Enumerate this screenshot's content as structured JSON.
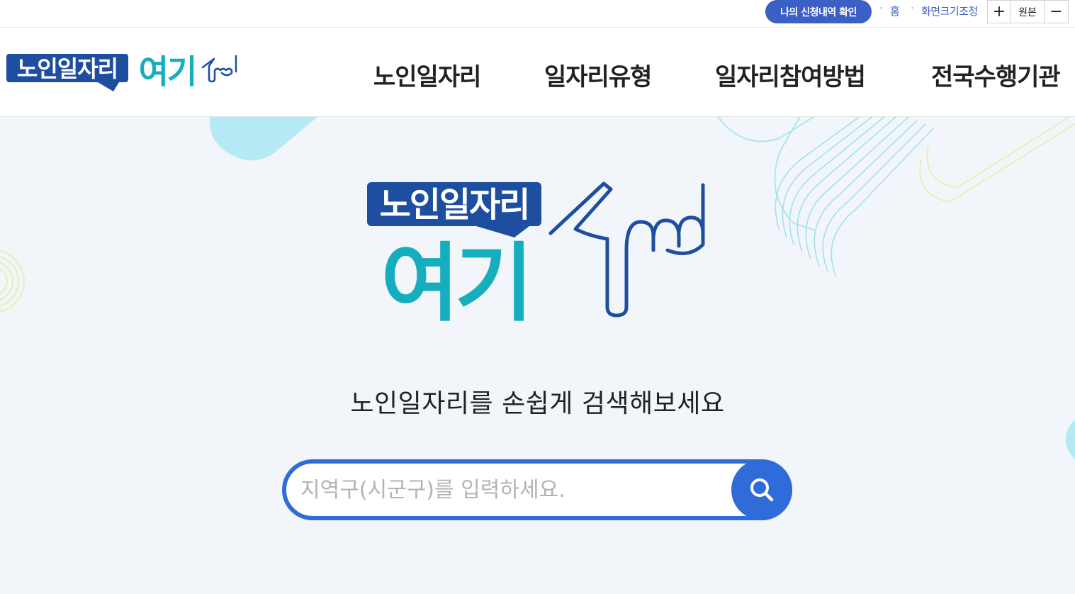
{
  "utility": {
    "my_apply": "나의 신청내역 확인",
    "home": "홈",
    "zoom_label": "화면크기조정",
    "zoom_in": "+",
    "zoom_original": "원본",
    "zoom_out": "−"
  },
  "logo": {
    "line1": "노인일자리",
    "line2": "여기"
  },
  "nav": {
    "items": [
      "노인일자리",
      "일자리유형",
      "일자리참여방법",
      "전국수행기관"
    ]
  },
  "hero": {
    "tagline": "노인일자리를 손쉽게 검색해보세요"
  },
  "search": {
    "value": "",
    "placeholder": "지역구(시군구)를 입력하세요."
  },
  "colors": {
    "brand_navy": "#1e4e9f",
    "brand_teal": "#15aebf",
    "accent_blue": "#2f6bd9"
  },
  "icons": {
    "search": "search-icon",
    "pointing_hand": "pointing-hand-icon"
  }
}
